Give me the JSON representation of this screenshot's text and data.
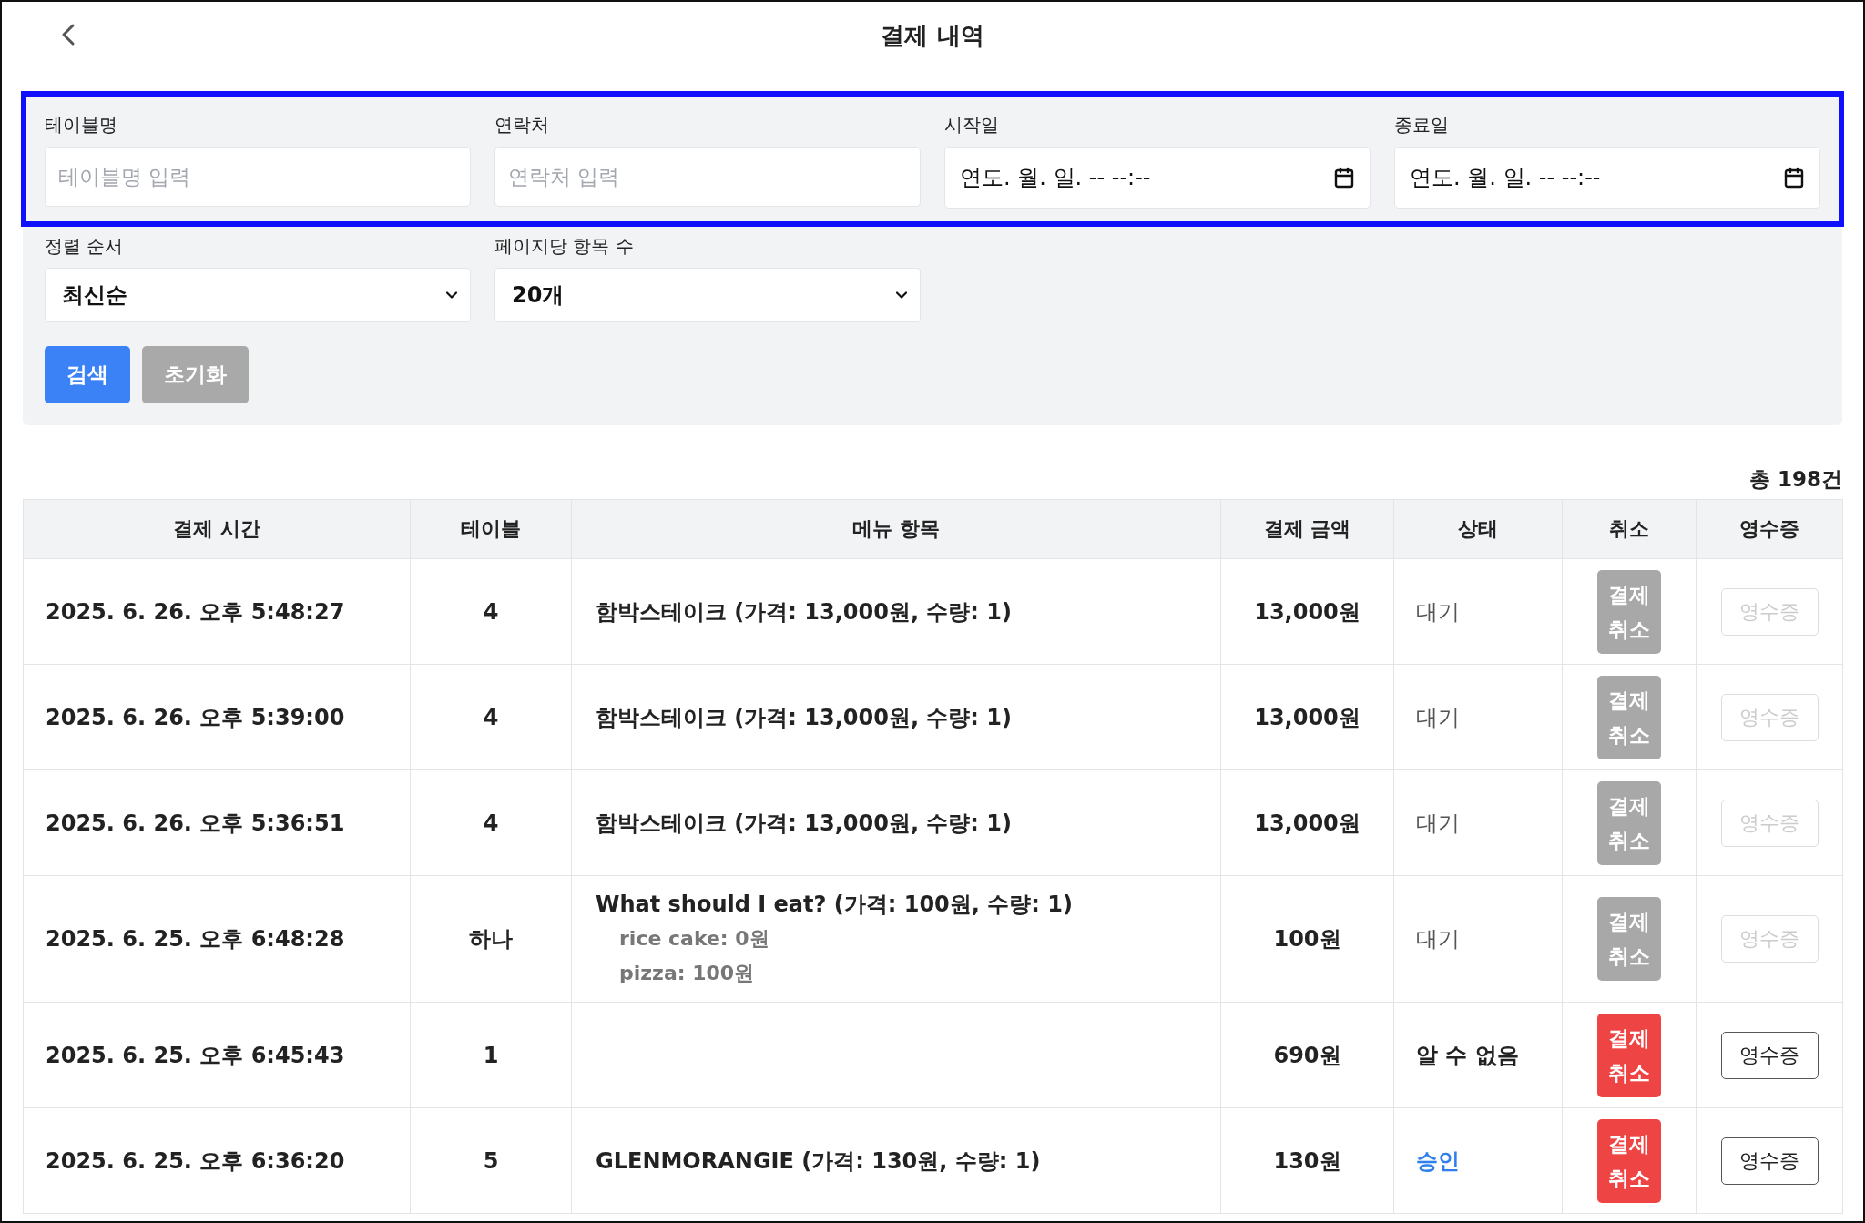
{
  "header": {
    "title": "결제 내역"
  },
  "filters": {
    "highlighted": true,
    "text_fields": [
      {
        "label": "테이블명",
        "placeholder": "테이블명 입력"
      },
      {
        "label": "연락처",
        "placeholder": "연락처 입력"
      }
    ],
    "date_fields": [
      {
        "label": "시작일",
        "value": "연도. 월. 일. -- --:--"
      },
      {
        "label": "종료일",
        "value": "연도. 월. 일. -- --:--"
      }
    ],
    "selects": [
      {
        "label": "정렬 순서",
        "value": "최신순"
      },
      {
        "label": "페이지당 항목 수",
        "value": "20개"
      }
    ],
    "buttons": [
      {
        "label": "검색",
        "kind": "primary"
      },
      {
        "label": "초기화",
        "kind": "secondary"
      }
    ]
  },
  "total": "총 198건",
  "table": {
    "columns": [
      "결제 시간",
      "테이블",
      "메뉴 항목",
      "결제 금액",
      "상태",
      "취소",
      "영수증"
    ],
    "rows": [
      {
        "time": "2025. 6. 26. 오후 5:48:27",
        "table": "4",
        "menu": [
          {
            "text": "함박스테이크 (가격: 13,000원, 수량: 1)"
          }
        ],
        "amount": "13,000원",
        "status": "대기",
        "color": "#555555",
        "cancel": {
          "label": "결제 취소",
          "disabled": true
        },
        "receipt": {
          "label": "영수증",
          "disabled": true
        }
      },
      {
        "time": "2025. 6. 26. 오후 5:39:00",
        "table": "4",
        "menu": [
          {
            "text": "함박스테이크 (가격: 13,000원, 수량: 1)"
          }
        ],
        "amount": "13,000원",
        "status": "대기",
        "color": "#555555",
        "cancel": {
          "label": "결제 취소",
          "disabled": true
        },
        "receipt": {
          "label": "영수증",
          "disabled": true
        }
      },
      {
        "time": "2025. 6. 26. 오후 5:36:51",
        "table": "4",
        "menu": [
          {
            "text": "함박스테이크 (가격: 13,000원, 수량: 1)"
          }
        ],
        "amount": "13,000원",
        "status": "대기",
        "color": "#555555",
        "cancel": {
          "label": "결제 취소",
          "disabled": true
        },
        "receipt": {
          "label": "영수증",
          "disabled": true
        }
      },
      {
        "time": "2025. 6. 25. 오후 6:48:28",
        "table": "하나",
        "menu": [
          {
            "text": "What should I eat? (가격: 100원, 수량: 1)",
            "options": [
              "rice cake: 0원",
              "pizza: 100원"
            ]
          }
        ],
        "amount": "100원",
        "status": "대기",
        "color": "#555555",
        "cancel": {
          "label": "결제 취소",
          "disabled": true
        },
        "receipt": {
          "label": "영수증",
          "disabled": true
        }
      },
      {
        "time": "2025. 6. 25. 오후 6:45:43",
        "table": "1",
        "amount": "690원",
        "status": "알 수 없음",
        "color": "#222222",
        "cancel": {
          "label": "결제 취소",
          "disabled": false
        },
        "receipt": {
          "label": "영수증",
          "disabled": false
        }
      },
      {
        "time": "2025. 6. 25. 오후 6:36:20",
        "table": "5",
        "menu": [
          {
            "text": "GLENMORANGIE (가격: 130원, 수량: 1)"
          }
        ],
        "amount": "130원",
        "status": "승인",
        "color": "#2f80ed",
        "cancel": {
          "label": "결제 취소",
          "disabled": false
        },
        "receipt": {
          "label": "영수증",
          "disabled": false
        }
      }
    ]
  }
}
